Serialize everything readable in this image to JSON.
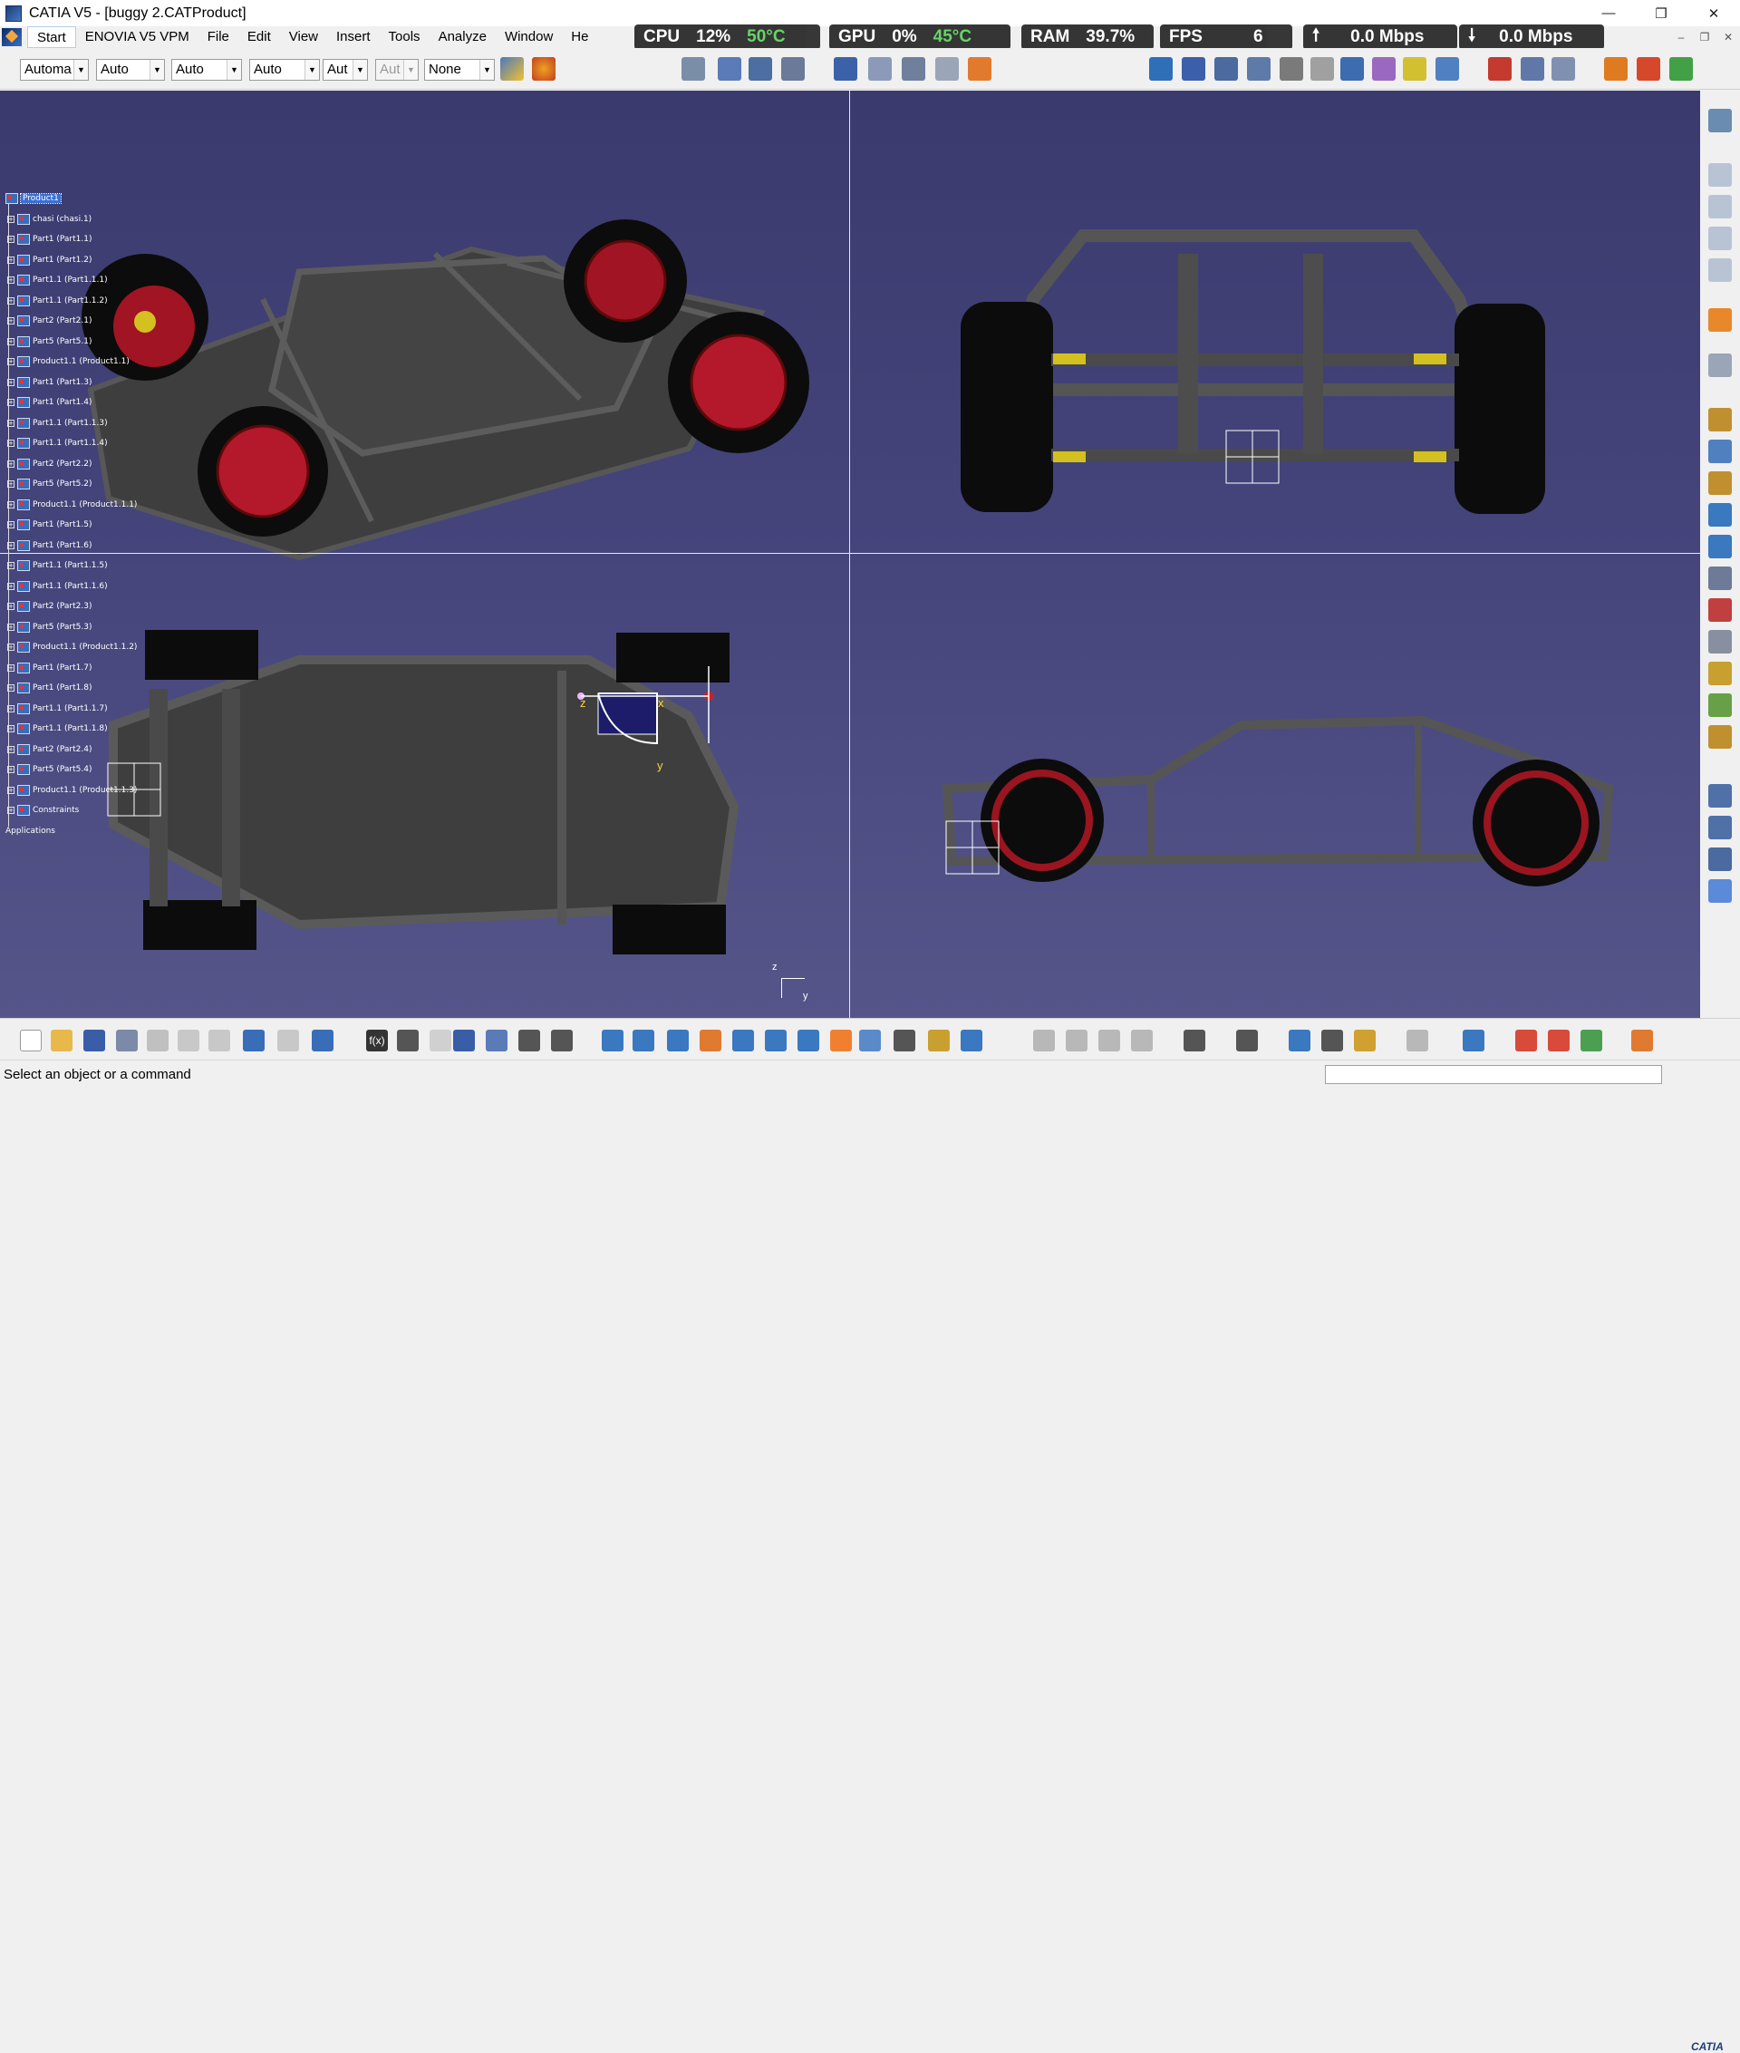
{
  "window": {
    "title": "CATIA V5 - [buggy 2.CATProduct]",
    "buttons": [
      "—",
      "❐",
      "✕"
    ]
  },
  "menu": {
    "items": [
      "Start",
      "ENOVIA V5 VPM",
      "File",
      "Edit",
      "View",
      "Insert",
      "Tools",
      "Analyze",
      "Window",
      "He"
    ]
  },
  "overlay": {
    "cpu_label": "CPU",
    "cpu_value": "12%",
    "cpu_temp": "50°C",
    "gpu_label": "GPU",
    "gpu_value": "0%",
    "gpu_temp": "45°C",
    "ram_label": "RAM",
    "ram_value": "39.7%",
    "fps_label": "FPS",
    "fps_value": "6",
    "up_arrow": "🠕",
    "up_value": "0.0 Mbps",
    "down_arrow": "🠗",
    "down_value": "0.0 Mbps"
  },
  "toolbar": {
    "combos": [
      "Automa",
      "Auto",
      "Auto",
      "Auto",
      "Aut",
      "Aut",
      "None"
    ]
  },
  "tree": {
    "items": [
      "Product1",
      "chasi (chasi.1)",
      "Part1 (Part1.1)",
      "Part1 (Part1.2)",
      "Part1.1 (Part1.1.1)",
      "Part1.1 (Part1.1.2)",
      "Part2 (Part2.1)",
      "Part5 (Part5.1)",
      "Product1.1 (Product1.1)",
      "Part1 (Part1.3)",
      "Part1 (Part1.4)",
      "Part1.1 (Part1.1.3)",
      "Part1.1 (Part1.1.4)",
      "Part2 (Part2.2)",
      "Part5 (Part5.2)",
      "Product1.1 (Product1.1.1)",
      "Part1 (Part1.5)",
      "Part1 (Part1.6)",
      "Part1.1 (Part1.1.5)",
      "Part1.1 (Part1.1.6)",
      "Part2 (Part2.3)",
      "Part5 (Part5.3)",
      "Product1.1 (Product1.1.2)",
      "Part1 (Part1.7)",
      "Part1 (Part1.8)",
      "Part1.1 (Part1.1.7)",
      "Part1.1 (Part1.1.8)",
      "Part2 (Part2.4)",
      "Part5 (Part5.4)",
      "Product1.1 (Product1.1.3)",
      "Constraints",
      "Applications"
    ]
  },
  "compass": {
    "z": "z",
    "x": "x",
    "y": "y"
  },
  "axis": {
    "z": "z",
    "y": "y"
  },
  "status": {
    "message": "Select an object or a command"
  },
  "brand": "CATIA"
}
